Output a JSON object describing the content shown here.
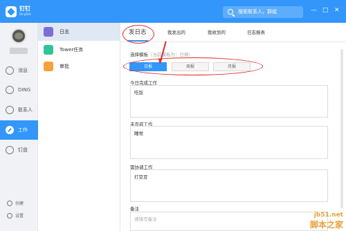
{
  "app": {
    "name": "钉钉",
    "name_en": "DingTalk"
  },
  "search": {
    "placeholder": "搜索联系人，群组"
  },
  "window_controls": {
    "minimize": "—",
    "maximize": "□",
    "close": "✕"
  },
  "leftnav": {
    "items": [
      {
        "label": "消息",
        "icon": "message-icon"
      },
      {
        "label": "DING",
        "icon": "ding-icon"
      },
      {
        "label": "联系人",
        "icon": "contacts-icon"
      },
      {
        "label": "工作",
        "icon": "work-icon",
        "active": true
      },
      {
        "label": "钉盘",
        "icon": "cloud-disk-icon"
      }
    ],
    "bottom": [
      {
        "label": "创建",
        "icon": "create-icon"
      },
      {
        "label": "设置",
        "icon": "settings-icon"
      }
    ]
  },
  "subnav": {
    "items": [
      {
        "label": "日志",
        "icon_color": "#7b6fd6",
        "active": true
      },
      {
        "label": "Tower任务",
        "icon_color": "#30c49b"
      },
      {
        "label": "审批",
        "icon_color": "#f6a13a"
      }
    ]
  },
  "tabs": [
    {
      "label": "发日志",
      "active": true
    },
    {
      "label": "我发出的"
    },
    {
      "label": "我收到的"
    },
    {
      "label": "日志报表"
    }
  ],
  "template": {
    "label": "选择模板",
    "hint": "（当前模板为：日报）",
    "options": [
      {
        "label": "日报",
        "active": true
      },
      {
        "label": "周报"
      },
      {
        "label": "月报"
      }
    ]
  },
  "fields": [
    {
      "label": "今日完成工作",
      "value": "吃饭"
    },
    {
      "label": "未完成工作",
      "value": "睡觉"
    },
    {
      "label": "需协调工作",
      "value": "打豆豆"
    },
    {
      "label": "备注",
      "placeholder": "请填写备注"
    }
  ],
  "watermark": {
    "url": "jb51.net",
    "site": "脚本之家"
  },
  "colors": {
    "primary": "#3296fa",
    "annotation": "#e0292b"
  }
}
